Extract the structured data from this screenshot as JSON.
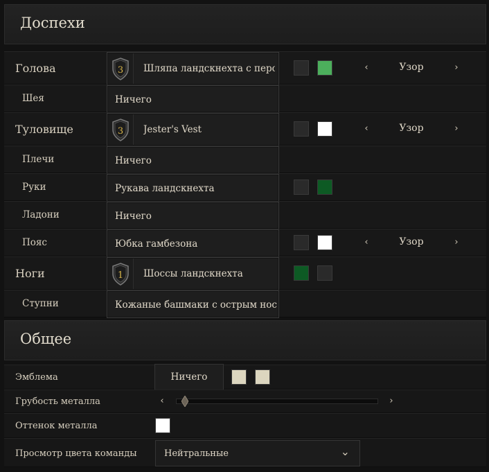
{
  "armor": {
    "title": "Доспехи",
    "slots": [
      {
        "label": "Голова",
        "item": "Шляпа ландскнехта с пером",
        "tier": "3",
        "color1": "#2a2a2a",
        "color2": "#4caf5c",
        "pattern": "Узор"
      },
      {
        "label": "Шея",
        "item": "Ничего"
      },
      {
        "label": "Туловище",
        "item": "Jester's Vest",
        "tier": "3",
        "color1": "#2a2a2a",
        "color2": "#ffffff",
        "pattern": "Узор"
      },
      {
        "label": "Плечи",
        "item": "Ничего"
      },
      {
        "label": "Руки",
        "item": "Рукава ландскнехта",
        "color1": "#2a2a2a",
        "color2": "#0d5a24"
      },
      {
        "label": "Ладони",
        "item": "Ничего"
      },
      {
        "label": "Пояс",
        "item": "Юбка гамбезона",
        "color1": "#2a2a2a",
        "color2": "#ffffff",
        "pattern": "Узор"
      },
      {
        "label": "Ноги",
        "item": "Шоссы ландскнехта",
        "tier": "1",
        "color1": "#0d5a24",
        "color2": "#2a2a2a"
      },
      {
        "label": "Ступни",
        "item": "Кожаные башмаки с острым носом"
      }
    ]
  },
  "general": {
    "title": "Общее",
    "emblem": {
      "label": "Эмблема",
      "value": "Ничего",
      "color1": "#dcd6bf",
      "color2": "#dcd6bf"
    },
    "roughness": {
      "label": "Грубость металла",
      "value": 0.02
    },
    "tint": {
      "label": "Оттенок металла",
      "color": "#ffffff"
    },
    "team_preview": {
      "label": "Просмотр цвета команды",
      "value": "Нейтральные"
    }
  },
  "icons": {
    "arrow_left": "‹",
    "arrow_right": "›",
    "chevron_down": "⌄"
  }
}
